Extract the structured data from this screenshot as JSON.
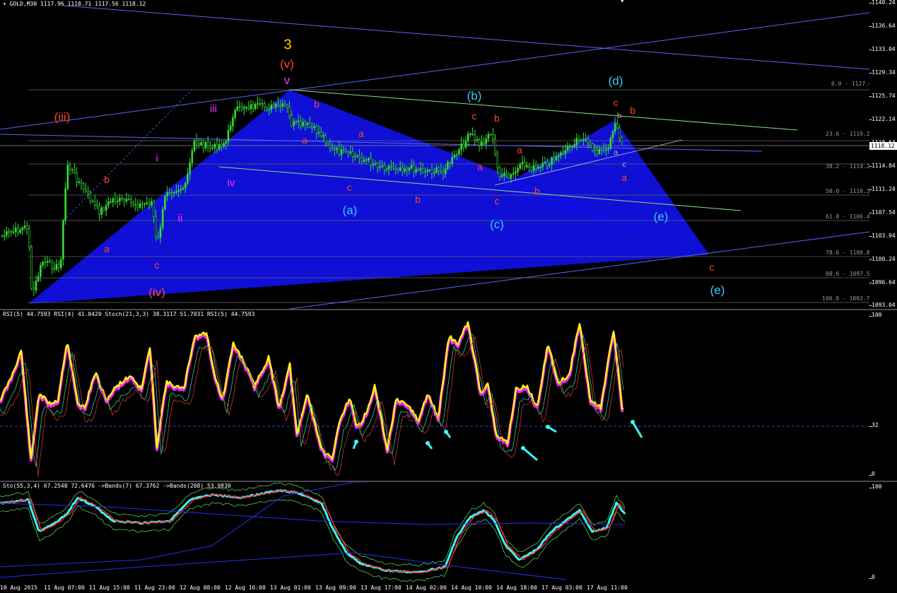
{
  "main_header": {
    "symbol": "GOLD,M30",
    "ohlc": "1117.96 1118.71 1117.56 1118.12"
  },
  "price_scale": [
    "1140.24",
    "1136.64",
    "1133.04",
    "1129.34",
    "1125.74",
    "1122.14",
    "1118.54",
    "1114.84",
    "1111.24",
    "1107.54",
    "1103.94",
    "1100.24",
    "1096.64",
    "1093.04"
  ],
  "current_price": "1118.12",
  "fib_levels": [
    "0.0 - 1127.07",
    "23.6 - 1119.20",
    "38.2 - 1114.23",
    "50.0 - 1110.39",
    "61.8 - 1106.46",
    "78.6 - 1100.86",
    "88.6 - 1097.52",
    "100.0 - 1093.72"
  ],
  "wave_labels": {
    "main_3": "3",
    "wave_v": "(v)",
    "v_small": "v",
    "iii_paren": "(iii)",
    "iv_paren": "(iv)",
    "i": "i",
    "ii": "ii",
    "iii": "iii",
    "iv": "iv",
    "a_paren": "(a)",
    "b_paren": "(b)",
    "c_paren": "(c)",
    "d_paren": "(d)",
    "e_paren": "(e)",
    "e_paren_2": "(e)",
    "a": "a",
    "b": "b",
    "c": "c",
    "b_grey": "b",
    "a_grey": "a",
    "c_grey": "c"
  },
  "rsi_header": "RSI(5) 44.7593  RSI(4) 41.0420  Stoch(21,3,3) 38.3117 51.7031  RSI(5) 44.7593",
  "rsi_scale": [
    "100",
    "32",
    "0"
  ],
  "stoch_header": "Sto(55,3,4) 67.2548 72.6476  ->Bands(7) 67.3762  ->Bands(208) 53.9830",
  "stoch_scale": [
    "100",
    "0"
  ],
  "time_axis": [
    "10 Aug 2015",
    "11 Aug 07:00",
    "11 Aug 15:00",
    "11 Aug 23:00",
    "12 Aug 08:00",
    "12 Aug 16:00",
    "13 Aug 01:00",
    "13 Aug 09:00",
    "13 Aug 17:00",
    "14 Aug 02:00",
    "14 Aug 10:00",
    "14 Aug 18:00",
    "17 Aug 03:00",
    "17 Aug 11:00"
  ],
  "colors": {
    "bg": "#000000",
    "candles": "#33dd33",
    "triangle": "#1010e0",
    "rsi_magenta": "#ff22ff",
    "rsi_yellow": "#ffff00",
    "stoch_cyan": "#33ffff",
    "stoch_red": "#ff2222",
    "wave_orange": "#ff4422",
    "wave_cyan": "#33ccff",
    "wave_magenta": "#ff33ff",
    "wave_gold": "#ffcc00",
    "arrow": "#33ffff"
  }
}
